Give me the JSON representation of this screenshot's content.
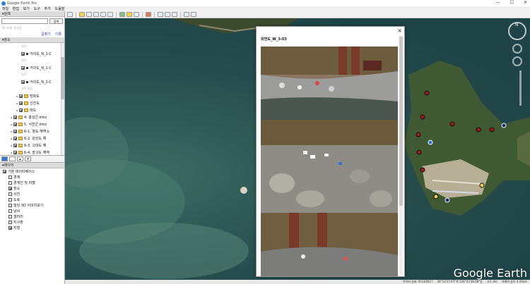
{
  "window": {
    "title": "Google Earth Pro"
  },
  "menu": [
    "파일(F)",
    "편집(E)",
    "보기(V)",
    "도구(T)",
    "추가(A)",
    "도움말(H)"
  ],
  "search": {
    "header": "▾검색",
    "placeholder": "",
    "button": "검색",
    "hint": "예: 호텔, 음식점",
    "links": [
      "길찾기",
      "기록"
    ]
  },
  "places": {
    "header": "▾장소",
    "items": [
      {
        "label": "경로",
        "type": "dim"
      },
      {
        "label": "거의도_N_1-C",
        "type": "point"
      },
      {
        "label": "경로",
        "type": "dim"
      },
      {
        "label": "거의도_N_1-C",
        "type": "point"
      },
      {
        "label": "경로",
        "type": "dim"
      },
      {
        "label": "거의도_N_2-C",
        "type": "point"
      },
      {
        "label": "경로 설정",
        "type": "dim"
      },
      {
        "label": "방화도",
        "type": "folder"
      },
      {
        "label": "신진도",
        "type": "folder"
      },
      {
        "label": "마도",
        "type": "folder"
      },
      {
        "label": "4. 홍성군.kmz",
        "type": "folder"
      },
      {
        "label": "5. 서천군.kmz",
        "type": "folder"
      },
      {
        "label": "6-1. 월도 해역.k",
        "type": "folder"
      },
      {
        "label": "6-2. 원산도 해",
        "type": "folder"
      },
      {
        "label": "6-3. 고대도 해",
        "type": "folder"
      },
      {
        "label": "6-4. 장고도 해역",
        "type": "folder"
      },
      {
        "label": "6-5. 외연도 해",
        "type": "selected"
      }
    ]
  },
  "layers": {
    "header": "▾레이어",
    "items": [
      "기본 데이터베이스",
      "경계",
      "경계선 및 라벨",
      "장소",
      "사진",
      "도로",
      "빌딩 3D 이미지보기",
      "날씨",
      "갤러리",
      "지구본",
      "지형"
    ]
  },
  "popup": {
    "title": "외연도_W_3-03",
    "close": "×"
  },
  "status": {
    "date": "이미지 날짜: 9/13/2017",
    "coords": "36°13'37.67\"북  126°03'38.68\"동",
    "elev": "고도  0m",
    "eye": "카메라 높이  4.41km"
  },
  "logo": "Google Earth",
  "compass_label": "N",
  "colors": {
    "selection": "#3575d3",
    "water": "#264c4d",
    "marker_red": "#9b1c1c"
  }
}
